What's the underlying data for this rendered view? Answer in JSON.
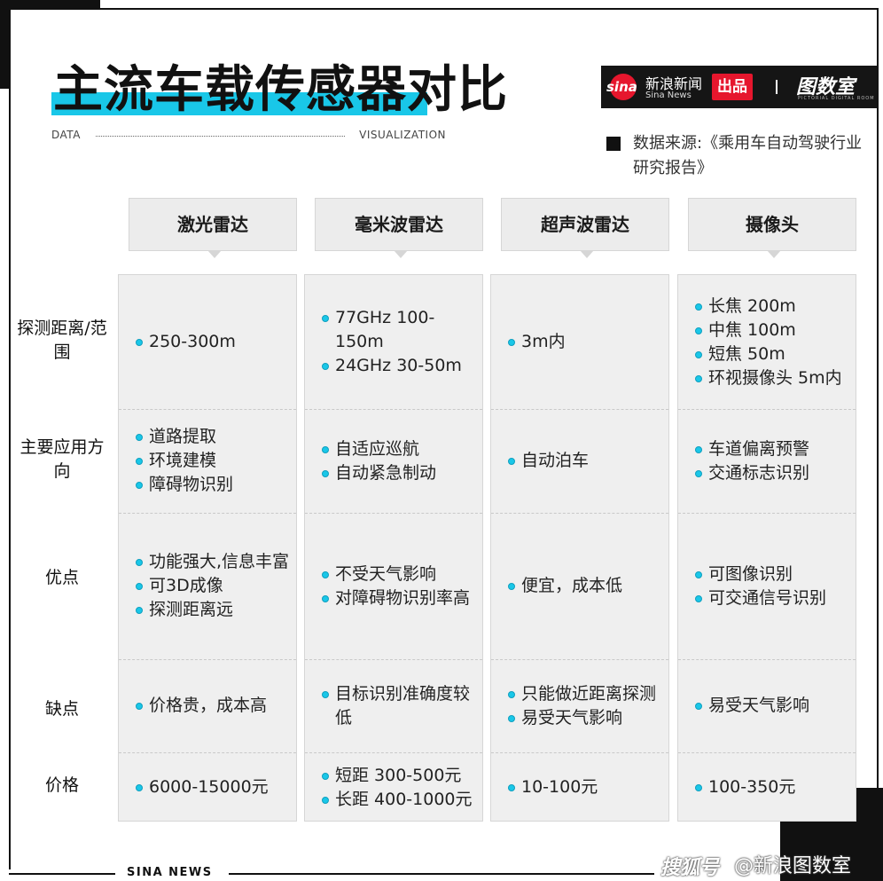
{
  "title": "主流车载传感器对比",
  "data_label": "DATA",
  "visualization_label": "VISUALIZATION",
  "brand": {
    "logo_text": "sina",
    "name_cn": "新浪新闻",
    "name_en": "Sina News",
    "badge": "出品",
    "sub_brand": "图数室",
    "sub_brand_en": "PICTORIAL DIGITAL ROOM"
  },
  "source": "数据来源:《乘用车自动驾驶行业研究报告》",
  "columns": [
    "激光雷达",
    "毫米波雷达",
    "超声波雷达",
    "摄像头"
  ],
  "rows": [
    {
      "label": "探测距离/范围",
      "cells": [
        [
          "250-300m"
        ],
        [
          "77GHz 100-150m",
          "24GHz 30-50m"
        ],
        [
          "3m内"
        ],
        [
          "长焦 200m",
          "中焦 100m",
          "短焦 50m",
          "环视摄像头 5m内"
        ]
      ]
    },
    {
      "label": "主要应用方向",
      "cells": [
        [
          "道路提取",
          "环境建模",
          "障碍物识别"
        ],
        [
          "自适应巡航",
          "自动紧急制动"
        ],
        [
          "自动泊车"
        ],
        [
          "车道偏离预警",
          "交通标志识别"
        ]
      ]
    },
    {
      "label": "优点",
      "cells": [
        [
          "功能强大,信息丰富",
          "可3D成像",
          "探测距离远"
        ],
        [
          "不受天气影响",
          "对障碍物识别率高"
        ],
        [
          "便宜，成本低"
        ],
        [
          "可图像识别",
          "可交通信号识别"
        ]
      ]
    },
    {
      "label": "缺点",
      "cells": [
        [
          "价格贵，成本高"
        ],
        [
          "目标识别准确度较低"
        ],
        [
          "只能做近距离探测",
          "易受天气影响"
        ],
        [
          "易受天气影响"
        ]
      ]
    },
    {
      "label": "价格",
      "cells": [
        [
          "6000-15000元"
        ],
        [
          "短距 300-500元",
          "长距 400-1000元"
        ],
        [
          "10-100元"
        ],
        [
          "100-350元"
        ]
      ]
    }
  ],
  "footer_left": "SINA NEWS",
  "footer_watermark": "@新浪图数室",
  "footer_watermark_logo": "搜狐号",
  "colors": {
    "accent": "#19c7e8",
    "brand_red": "#e6162d"
  }
}
